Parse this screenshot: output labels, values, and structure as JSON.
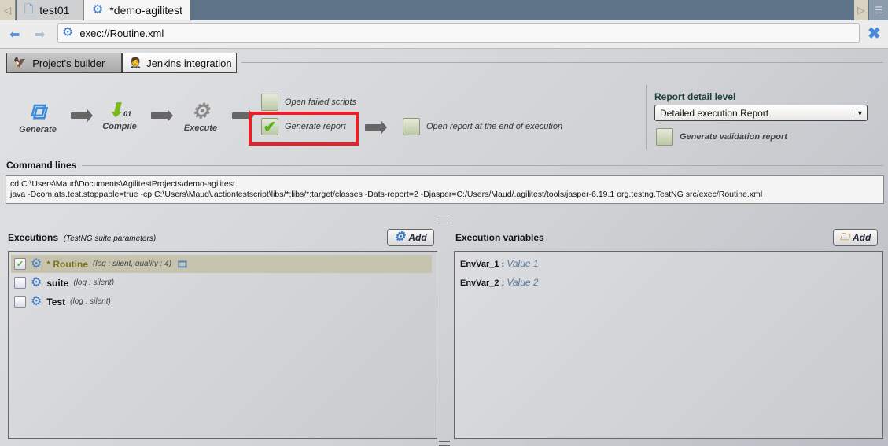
{
  "tabs": [
    {
      "label": "test01",
      "active": false
    },
    {
      "label": "*demo-agilitest",
      "active": true
    }
  ],
  "address": {
    "value": "exec://Routine.xml"
  },
  "view_tabs": [
    {
      "label": "Project's builder",
      "active": true
    },
    {
      "label": "Jenkins integration",
      "active": false
    }
  ],
  "workflow": {
    "steps": [
      {
        "label": "Generate",
        "icon": "cubes-icon"
      },
      {
        "label": "Compile",
        "icon": "binary-arrow-icon"
      },
      {
        "label": "Execute",
        "icon": "gears-icon"
      }
    ],
    "open_failed_scripts": {
      "label": "Open failed scripts",
      "checked": false
    },
    "generate_report": {
      "label": "Generate report",
      "checked": true
    },
    "open_report": {
      "label": "Open  report at the end of execution",
      "checked": false
    },
    "highlight_color": "#e8202a"
  },
  "report": {
    "title": "Report detail level",
    "selected": "Detailed execution Report",
    "validation": {
      "label": "Generate validation report",
      "checked": false
    }
  },
  "command": {
    "title": "Command lines",
    "lines": [
      "cd C:\\Users\\Maud\\Documents\\AgilitestProjects\\demo-agilitest",
      "java -Dcom.ats.test.stoppable=true -cp C:\\Users\\Maud\\.actiontestscript\\libs/*;libs/*;target/classes -Dats-report=2 -Djasper=C:/Users/Maud/.agilitest/tools/jasper-6.19.1 org.testng.TestNG src/exec/Routine.xml"
    ]
  },
  "executions": {
    "title": "Executions",
    "subtitle": "(TestNG suite parameters)",
    "add_label": "Add",
    "items": [
      {
        "name": "* Routine",
        "params": "(log : silent, quality : 4)",
        "checked": true,
        "selected": true
      },
      {
        "name": "suite",
        "params": "(log : silent)",
        "checked": false
      },
      {
        "name": "Test",
        "params": "(log : silent)",
        "checked": false
      }
    ]
  },
  "variables": {
    "title": "Execution variables",
    "add_label": "Add",
    "items": [
      {
        "name": "EnvVar_1 :",
        "value": "Value 1"
      },
      {
        "name": "EnvVar_2 :",
        "value": "Value 2"
      }
    ]
  }
}
